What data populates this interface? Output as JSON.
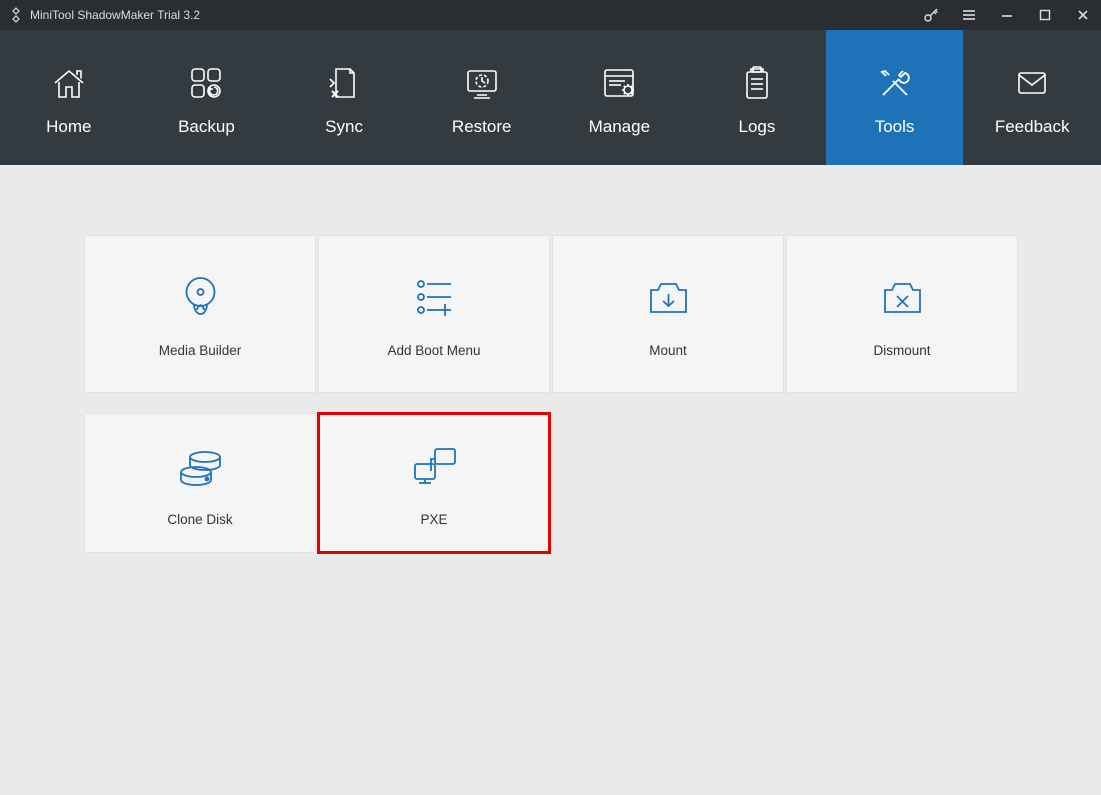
{
  "app": {
    "title": "MiniTool ShadowMaker Trial 3.2"
  },
  "nav": {
    "items": [
      {
        "label": "Home"
      },
      {
        "label": "Backup"
      },
      {
        "label": "Sync"
      },
      {
        "label": "Restore"
      },
      {
        "label": "Manage"
      },
      {
        "label": "Logs"
      },
      {
        "label": "Tools"
      },
      {
        "label": "Feedback"
      }
    ]
  },
  "tools": {
    "cards": [
      {
        "label": "Media Builder"
      },
      {
        "label": "Add Boot Menu"
      },
      {
        "label": "Mount"
      },
      {
        "label": "Dismount"
      },
      {
        "label": "Clone Disk"
      },
      {
        "label": "PXE"
      }
    ]
  }
}
